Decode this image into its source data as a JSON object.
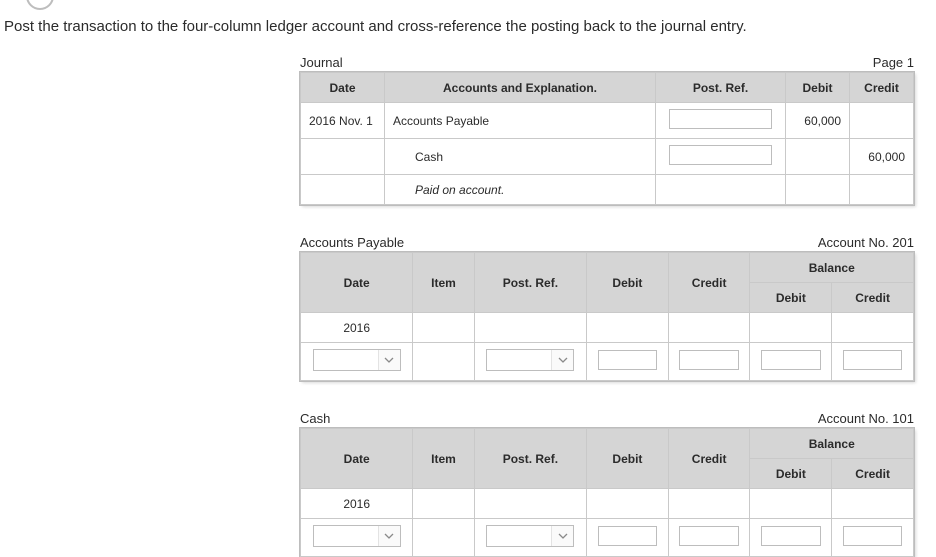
{
  "instruction": "Post the transaction to the four-column ledger account and cross-reference the posting back to the journal entry.",
  "journal": {
    "title": "Journal",
    "page": "Page 1",
    "headers": {
      "date": "Date",
      "accounts": "Accounts and Explanation.",
      "postref": "Post. Ref.",
      "debit": "Debit",
      "credit": "Credit"
    },
    "rows": [
      {
        "date": "2016 Nov. 1",
        "account": "Accounts Payable",
        "postref_input": true,
        "debit": "60,000",
        "credit": ""
      },
      {
        "date": "",
        "account": "Cash",
        "indent": true,
        "postref_input": true,
        "debit": "",
        "credit": "60,000"
      },
      {
        "date": "",
        "account": "Paid on account.",
        "italic": true,
        "postref_input": false,
        "debit": "",
        "credit": ""
      }
    ]
  },
  "ledger_headers": {
    "date": "Date",
    "item": "Item",
    "postref": "Post. Ref.",
    "debit": "Debit",
    "credit": "Credit",
    "balance": "Balance"
  },
  "ap": {
    "title": "Accounts Payable",
    "account_no": "Account No. 201",
    "year": "2016"
  },
  "cash": {
    "title": "Cash",
    "account_no": "Account No. 101",
    "year": "2016"
  }
}
